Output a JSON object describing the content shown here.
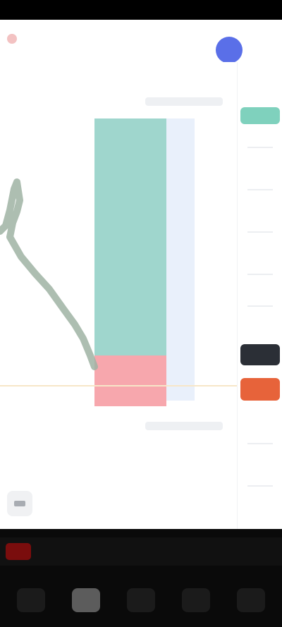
{
  "status_bar": {},
  "header": {
    "title": "",
    "subtitle": ""
  },
  "chart": {
    "colors": {
      "profit_zone": "#9fd6cd",
      "loss_zone": "#f7a7ad",
      "price_line": "#9fb3a3",
      "entry_line": "#f7e6c8",
      "avatar": "#5a6fe8",
      "tag_top": "#7fd1bd",
      "tag_mid": "#2b2f36",
      "tag_low": "#e7633a"
    }
  },
  "toolbar": {
    "icons": [
      "drawing-tool-icon"
    ]
  },
  "bottom_nav": {
    "items": [
      "nav-item-1",
      "nav-item-2",
      "nav-item-3",
      "nav-item-4",
      "nav-item-5"
    ],
    "active_index": 1
  }
}
